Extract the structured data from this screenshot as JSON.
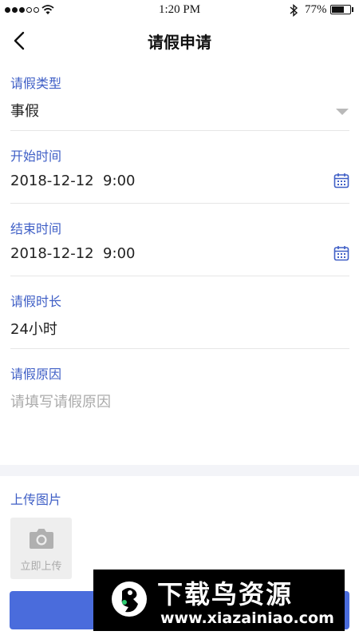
{
  "status_bar": {
    "time": "1:20 PM",
    "battery_percent": "77%",
    "battery_level": 0.77,
    "signal_bars_filled": 3,
    "signal_bars_total": 5
  },
  "nav": {
    "title": "请假申请",
    "back_icon": "chevron-left-icon"
  },
  "form": {
    "leave_type": {
      "label": "请假类型",
      "value": "事假",
      "icon": "caret-down-icon"
    },
    "start_time": {
      "label": "开始时间",
      "value": "2018-12-12  9:00",
      "icon": "calendar-icon"
    },
    "end_time": {
      "label": "结束时间",
      "value": "2018-12-12  9:00",
      "icon": "calendar-icon"
    },
    "duration": {
      "label": "请假时长",
      "value": "24小时"
    },
    "reason": {
      "label": "请假原因",
      "placeholder": "请填写请假原因"
    }
  },
  "upload": {
    "label": "上传图片",
    "button_text": "立即上传",
    "icon": "camera-icon"
  },
  "watermark": {
    "title": "下载鸟资源",
    "url": "www.xiazainiao.com"
  },
  "colors": {
    "accent": "#3f5fc6",
    "button": "#4a6cdc"
  }
}
